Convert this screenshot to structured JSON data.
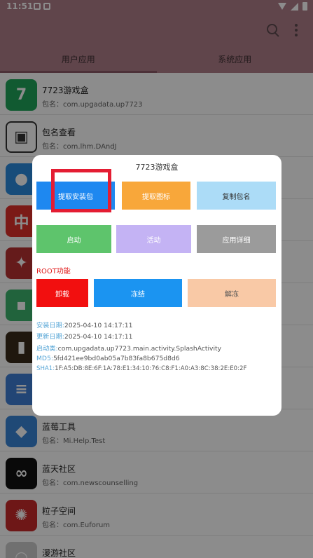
{
  "status_bar": {
    "time": "11:51"
  },
  "tabs": [
    {
      "label": "用户应用",
      "active": true
    },
    {
      "label": "系统应用",
      "active": false
    }
  ],
  "apps": [
    {
      "name": "7723游戏盒",
      "pkg": "包名：com.upgadata.up7723",
      "icon": "seven-icon",
      "color": "#1fa55a"
    },
    {
      "name": "包名查看",
      "pkg": "包名：com.lhm.DAndJ",
      "icon": "box-icon",
      "color": "#ffffff"
    },
    {
      "name": "",
      "pkg": "",
      "icon": "doraemon-icon",
      "color": "#2a8adf"
    },
    {
      "name": "",
      "pkg": "",
      "icon": "zhong-icon",
      "color": "#e1302b"
    },
    {
      "name": "",
      "pkg": "",
      "icon": "community-icon",
      "color": "#b93232"
    },
    {
      "name": "",
      "pkg": "",
      "icon": "android-icon",
      "color": "#3db46d"
    },
    {
      "name": "",
      "pkg": "",
      "icon": "photo-icon",
      "color": "#3a2a1a"
    },
    {
      "name": "",
      "pkg": "",
      "icon": "dumbbell-icon",
      "color": "#3f7fd6"
    },
    {
      "name": "蓝莓工具",
      "pkg": "包名：Mi.Help.Test",
      "icon": "cube-icon",
      "color": "#3a86d8"
    },
    {
      "name": "蓝天社区",
      "pkg": "包名：com.newscounselling",
      "icon": "rings-icon",
      "color": "#111111"
    },
    {
      "name": "粒子空间",
      "pkg": "包名：com.Euforum",
      "icon": "particle-icon",
      "color": "#c92a2a"
    },
    {
      "name": "漫游社区",
      "pkg": "",
      "icon": "roam-icon",
      "color": "#cccccc"
    }
  ],
  "dialog": {
    "title": "7723游戏盒",
    "buttons": {
      "extract_apk": "提取安装包",
      "extract_icon": "提取图标",
      "copy_pkg": "复制包名",
      "launch": "启动",
      "activity": "活动",
      "app_detail": "应用详细",
      "uninstall": "卸载",
      "freeze": "冻结",
      "unfreeze": "解冻"
    },
    "root_label": "ROOT功能",
    "info": {
      "install_key": "安装日期:",
      "install_val": "2025-04-10 14:17:11",
      "update_key": "更新日期:",
      "update_val": "2025-04-10 14:17:11",
      "launch_key": "启动类:",
      "launch_val": "com.upgadata.up7723.main.activity.SplashActivity",
      "md5_key": "MD5:",
      "md5_val": "5fd421ee9bd0ab05a7b83fa8b675d8d6",
      "sha1_key": "SHA1:",
      "sha1_val": "1F:A5:DB:8E:6F:1A:78:E1:34:10:76:C8:F1:A0:A3:8C:38:2E:E0:2F"
    }
  },
  "colors": {
    "app_bar": "#b07f89",
    "blue_btn": "#1e88f0",
    "orange_btn": "#f8a73a",
    "lightblue_btn": "#acdcf7",
    "green_btn": "#5ec46c",
    "purple_btn": "#c4b3f4",
    "gray_btn": "#9b9b9b",
    "red_btn": "#f20f0f",
    "freeze_btn": "#1b94f1",
    "peach_btn": "#f9c9a6",
    "highlight": "#e41d33"
  }
}
